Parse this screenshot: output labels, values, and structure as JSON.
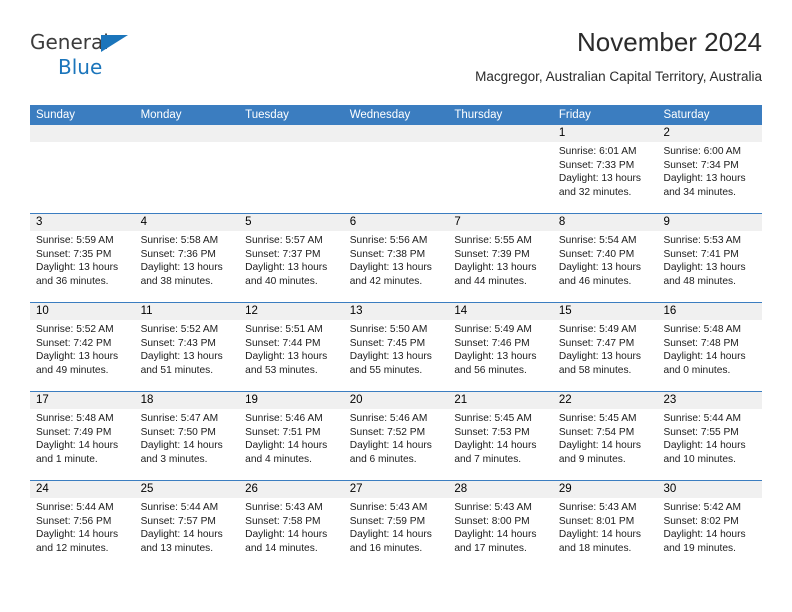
{
  "brand": {
    "name_part1": "General",
    "name_part2": "Blue",
    "logo_icon": "triangle-flag-icon",
    "accent_color": "#1b75bb"
  },
  "header": {
    "title": "November 2024",
    "subtitle": "Macgregor, Australian Capital Territory, Australia"
  },
  "calendar": {
    "header_bg": "#3b7dc0",
    "datenum_bg": "#f0f0f0",
    "weekdays": [
      "Sunday",
      "Monday",
      "Tuesday",
      "Wednesday",
      "Thursday",
      "Friday",
      "Saturday"
    ],
    "weeks": [
      [
        {
          "day": "",
          "empty": true
        },
        {
          "day": "",
          "empty": true
        },
        {
          "day": "",
          "empty": true
        },
        {
          "day": "",
          "empty": true
        },
        {
          "day": "",
          "empty": true
        },
        {
          "day": "1",
          "sunrise": "Sunrise: 6:01 AM",
          "sunset": "Sunset: 7:33 PM",
          "daylight1": "Daylight: 13 hours",
          "daylight2": "and 32 minutes."
        },
        {
          "day": "2",
          "sunrise": "Sunrise: 6:00 AM",
          "sunset": "Sunset: 7:34 PM",
          "daylight1": "Daylight: 13 hours",
          "daylight2": "and 34 minutes."
        }
      ],
      [
        {
          "day": "3",
          "sunrise": "Sunrise: 5:59 AM",
          "sunset": "Sunset: 7:35 PM",
          "daylight1": "Daylight: 13 hours",
          "daylight2": "and 36 minutes."
        },
        {
          "day": "4",
          "sunrise": "Sunrise: 5:58 AM",
          "sunset": "Sunset: 7:36 PM",
          "daylight1": "Daylight: 13 hours",
          "daylight2": "and 38 minutes."
        },
        {
          "day": "5",
          "sunrise": "Sunrise: 5:57 AM",
          "sunset": "Sunset: 7:37 PM",
          "daylight1": "Daylight: 13 hours",
          "daylight2": "and 40 minutes."
        },
        {
          "day": "6",
          "sunrise": "Sunrise: 5:56 AM",
          "sunset": "Sunset: 7:38 PM",
          "daylight1": "Daylight: 13 hours",
          "daylight2": "and 42 minutes."
        },
        {
          "day": "7",
          "sunrise": "Sunrise: 5:55 AM",
          "sunset": "Sunset: 7:39 PM",
          "daylight1": "Daylight: 13 hours",
          "daylight2": "and 44 minutes."
        },
        {
          "day": "8",
          "sunrise": "Sunrise: 5:54 AM",
          "sunset": "Sunset: 7:40 PM",
          "daylight1": "Daylight: 13 hours",
          "daylight2": "and 46 minutes."
        },
        {
          "day": "9",
          "sunrise": "Sunrise: 5:53 AM",
          "sunset": "Sunset: 7:41 PM",
          "daylight1": "Daylight: 13 hours",
          "daylight2": "and 48 minutes."
        }
      ],
      [
        {
          "day": "10",
          "sunrise": "Sunrise: 5:52 AM",
          "sunset": "Sunset: 7:42 PM",
          "daylight1": "Daylight: 13 hours",
          "daylight2": "and 49 minutes."
        },
        {
          "day": "11",
          "sunrise": "Sunrise: 5:52 AM",
          "sunset": "Sunset: 7:43 PM",
          "daylight1": "Daylight: 13 hours",
          "daylight2": "and 51 minutes."
        },
        {
          "day": "12",
          "sunrise": "Sunrise: 5:51 AM",
          "sunset": "Sunset: 7:44 PM",
          "daylight1": "Daylight: 13 hours",
          "daylight2": "and 53 minutes."
        },
        {
          "day": "13",
          "sunrise": "Sunrise: 5:50 AM",
          "sunset": "Sunset: 7:45 PM",
          "daylight1": "Daylight: 13 hours",
          "daylight2": "and 55 minutes."
        },
        {
          "day": "14",
          "sunrise": "Sunrise: 5:49 AM",
          "sunset": "Sunset: 7:46 PM",
          "daylight1": "Daylight: 13 hours",
          "daylight2": "and 56 minutes."
        },
        {
          "day": "15",
          "sunrise": "Sunrise: 5:49 AM",
          "sunset": "Sunset: 7:47 PM",
          "daylight1": "Daylight: 13 hours",
          "daylight2": "and 58 minutes."
        },
        {
          "day": "16",
          "sunrise": "Sunrise: 5:48 AM",
          "sunset": "Sunset: 7:48 PM",
          "daylight1": "Daylight: 14 hours",
          "daylight2": "and 0 minutes."
        }
      ],
      [
        {
          "day": "17",
          "sunrise": "Sunrise: 5:48 AM",
          "sunset": "Sunset: 7:49 PM",
          "daylight1": "Daylight: 14 hours",
          "daylight2": "and 1 minute."
        },
        {
          "day": "18",
          "sunrise": "Sunrise: 5:47 AM",
          "sunset": "Sunset: 7:50 PM",
          "daylight1": "Daylight: 14 hours",
          "daylight2": "and 3 minutes."
        },
        {
          "day": "19",
          "sunrise": "Sunrise: 5:46 AM",
          "sunset": "Sunset: 7:51 PM",
          "daylight1": "Daylight: 14 hours",
          "daylight2": "and 4 minutes."
        },
        {
          "day": "20",
          "sunrise": "Sunrise: 5:46 AM",
          "sunset": "Sunset: 7:52 PM",
          "daylight1": "Daylight: 14 hours",
          "daylight2": "and 6 minutes."
        },
        {
          "day": "21",
          "sunrise": "Sunrise: 5:45 AM",
          "sunset": "Sunset: 7:53 PM",
          "daylight1": "Daylight: 14 hours",
          "daylight2": "and 7 minutes."
        },
        {
          "day": "22",
          "sunrise": "Sunrise: 5:45 AM",
          "sunset": "Sunset: 7:54 PM",
          "daylight1": "Daylight: 14 hours",
          "daylight2": "and 9 minutes."
        },
        {
          "day": "23",
          "sunrise": "Sunrise: 5:44 AM",
          "sunset": "Sunset: 7:55 PM",
          "daylight1": "Daylight: 14 hours",
          "daylight2": "and 10 minutes."
        }
      ],
      [
        {
          "day": "24",
          "sunrise": "Sunrise: 5:44 AM",
          "sunset": "Sunset: 7:56 PM",
          "daylight1": "Daylight: 14 hours",
          "daylight2": "and 12 minutes."
        },
        {
          "day": "25",
          "sunrise": "Sunrise: 5:44 AM",
          "sunset": "Sunset: 7:57 PM",
          "daylight1": "Daylight: 14 hours",
          "daylight2": "and 13 minutes."
        },
        {
          "day": "26",
          "sunrise": "Sunrise: 5:43 AM",
          "sunset": "Sunset: 7:58 PM",
          "daylight1": "Daylight: 14 hours",
          "daylight2": "and 14 minutes."
        },
        {
          "day": "27",
          "sunrise": "Sunrise: 5:43 AM",
          "sunset": "Sunset: 7:59 PM",
          "daylight1": "Daylight: 14 hours",
          "daylight2": "and 16 minutes."
        },
        {
          "day": "28",
          "sunrise": "Sunrise: 5:43 AM",
          "sunset": "Sunset: 8:00 PM",
          "daylight1": "Daylight: 14 hours",
          "daylight2": "and 17 minutes."
        },
        {
          "day": "29",
          "sunrise": "Sunrise: 5:43 AM",
          "sunset": "Sunset: 8:01 PM",
          "daylight1": "Daylight: 14 hours",
          "daylight2": "and 18 minutes."
        },
        {
          "day": "30",
          "sunrise": "Sunrise: 5:42 AM",
          "sunset": "Sunset: 8:02 PM",
          "daylight1": "Daylight: 14 hours",
          "daylight2": "and 19 minutes."
        }
      ]
    ]
  }
}
